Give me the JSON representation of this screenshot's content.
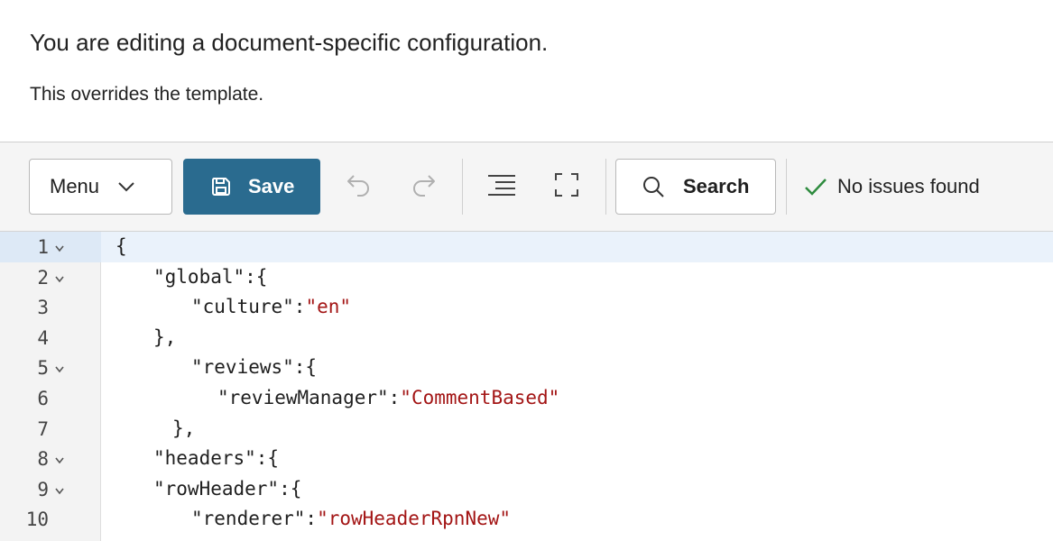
{
  "header": {
    "title": "You are editing a document-specific configuration.",
    "subtitle": "This overrides the template."
  },
  "toolbar": {
    "menu_label": "Menu",
    "save_label": "Save",
    "search_label": "Search",
    "status_text": "No issues found",
    "colors": {
      "save_bg": "#2a6b8f",
      "status_check": "#2e8b3e"
    },
    "icons": [
      "chevron-down-icon",
      "save-icon",
      "undo-icon",
      "redo-icon",
      "format-icon",
      "fullscreen-icon",
      "search-icon",
      "check-icon"
    ]
  },
  "editor": {
    "lines": [
      {
        "num": "1",
        "indent": 0,
        "key": "{",
        "value": "",
        "foldable": true
      },
      {
        "num": "2",
        "indent": 2,
        "key": "\"global\":{",
        "value": "",
        "foldable": true
      },
      {
        "num": "3",
        "indent": 4,
        "key": "\"culture\":",
        "value": "\"en\"",
        "foldable": false
      },
      {
        "num": "4",
        "indent": 2,
        "key": "},",
        "value": "",
        "foldable": false
      },
      {
        "num": "5",
        "indent": 4,
        "key": "\"reviews\":{",
        "value": "",
        "foldable": true
      },
      {
        "num": "6",
        "indent": 5,
        "key": "\"reviewManager\":",
        "value": "\"CommentBased\"",
        "foldable": false
      },
      {
        "num": "7",
        "indent": 3,
        "key": "},",
        "value": "",
        "foldable": false
      },
      {
        "num": "8",
        "indent": 2,
        "key": "\"headers\":{",
        "value": "",
        "foldable": true
      },
      {
        "num": "9",
        "indent": 2,
        "key": "\"rowHeader\":{",
        "value": "",
        "foldable": true
      },
      {
        "num": "10",
        "indent": 4,
        "key": "\"renderer\":",
        "value": "\"rowHeaderRpnNew\"",
        "foldable": false
      }
    ],
    "colors": {
      "string_value": "#a31515",
      "active_line_bg": "#eaf2fb"
    }
  }
}
